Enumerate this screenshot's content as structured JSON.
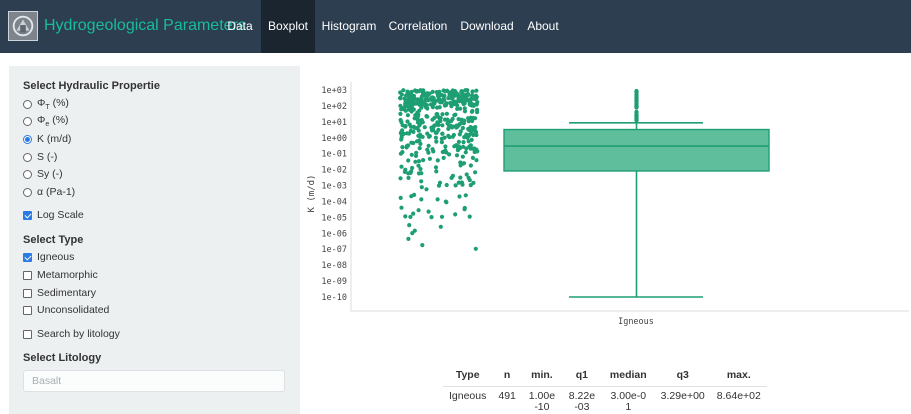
{
  "navbar": {
    "brand": "Hydrogeological Parameters",
    "tabs": [
      {
        "label": "Data"
      },
      {
        "label": "Boxplot"
      },
      {
        "label": "Histogram"
      },
      {
        "label": "Correlation"
      },
      {
        "label": "Download"
      },
      {
        "label": "About"
      }
    ],
    "active_tab": "Boxplot"
  },
  "sidebar": {
    "property_title": "Select Hydraulic Propertie",
    "properties": [
      {
        "label": "ΦT (%)",
        "base": "Φ",
        "sub": "T",
        "rest": " (%)",
        "selected": false
      },
      {
        "label": "Φe (%)",
        "base": "Φ",
        "sub": "e",
        "rest": " (%)",
        "selected": false
      },
      {
        "label": "K (m/d)",
        "base": "K (m/d)",
        "sub": "",
        "rest": "",
        "selected": true
      },
      {
        "label": "S (-)",
        "base": "S (-)",
        "sub": "",
        "rest": "",
        "selected": false
      },
      {
        "label": "Sy (-)",
        "base": "Sy (-)",
        "sub": "",
        "rest": "",
        "selected": false
      },
      {
        "label": "α (Pa-1)",
        "base": "α (Pa-1)",
        "sub": "",
        "rest": "",
        "selected": false
      }
    ],
    "log_scale_label": "Log Scale",
    "log_scale_checked": true,
    "type_title": "Select Type",
    "types": [
      {
        "label": "Igneous",
        "checked": true
      },
      {
        "label": "Metamorphic",
        "checked": false
      },
      {
        "label": "Sedimentary",
        "checked": false
      },
      {
        "label": "Unconsolidated",
        "checked": false
      }
    ],
    "search_litology_label": "Search by litology",
    "search_litology_checked": false,
    "litology_title": "Select Litology",
    "litology_placeholder": "Basalt"
  },
  "chart_data": {
    "type": "box",
    "ylabel": "K (m/d)",
    "yscale": "log",
    "ylim": [
      1e-10,
      1000
    ],
    "ytick_labels": [
      "1e+03",
      "1e+02",
      "1e+01",
      "1e+00",
      "1e-01",
      "1e-02",
      "1e-03",
      "1e-04",
      "1e-05",
      "1e-06",
      "1e-07",
      "1e-08",
      "1e-09",
      "1e-10"
    ],
    "categories": [
      "Igneous"
    ],
    "colors": {
      "marker": "#1e9e73",
      "box_fill": "#5fbf9c",
      "box_line": "#1e9e73"
    },
    "box": {
      "min": 1e-10,
      "q1": 0.00822,
      "median": 0.3,
      "q3": 3.29,
      "whisker_high": 8.64,
      "max": 864
    },
    "n_points": 491
  },
  "summary_table": {
    "headers": [
      "Type",
      "n",
      "min.",
      "q1",
      "median",
      "q3",
      "max."
    ],
    "rows": [
      [
        "Igneous",
        "491",
        "1.00e-10",
        "8.22e-03",
        "3.00e-01",
        "3.29e+00",
        "8.64e+02"
      ]
    ]
  }
}
